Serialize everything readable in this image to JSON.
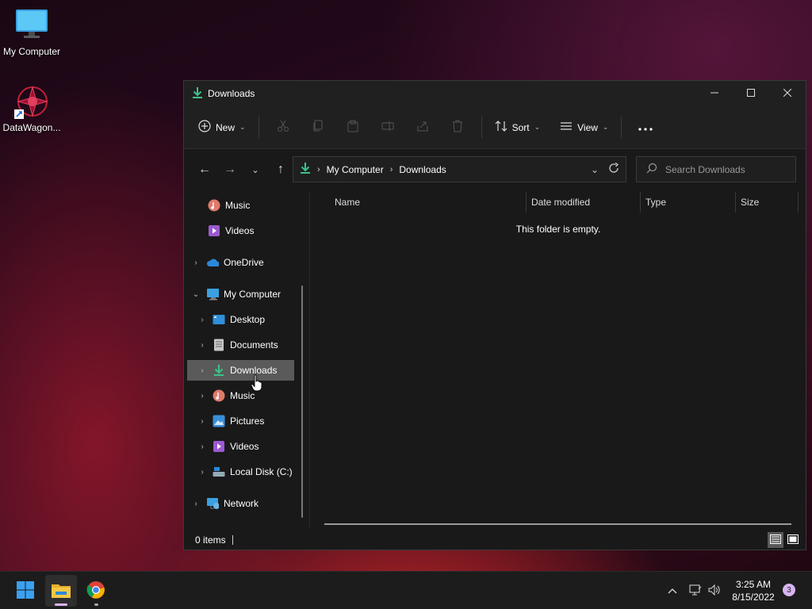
{
  "desktop": {
    "icons": [
      {
        "label": "My Computer",
        "icon": "monitor-icon"
      },
      {
        "label": "DataWagon...",
        "icon": "datawagon-shortcut-icon"
      }
    ]
  },
  "window": {
    "title": "Downloads",
    "controls": {
      "minimize": "minimize-icon",
      "maximize": "maximize-icon",
      "close": "close-icon"
    }
  },
  "toolbar": {
    "new_label": "New",
    "sort_label": "Sort",
    "view_label": "View",
    "disabled_actions": [
      "cut",
      "copy",
      "paste",
      "rename",
      "share",
      "delete"
    ]
  },
  "address": {
    "crumbs": [
      "My Computer",
      "Downloads"
    ],
    "search_placeholder": "Search Downloads"
  },
  "sidebar": {
    "items": [
      {
        "label": "Music",
        "icon": "music-icon",
        "expandable": false
      },
      {
        "label": "Videos",
        "icon": "videos-icon",
        "expandable": false
      },
      {
        "label": "OneDrive",
        "icon": "onedrive-icon",
        "expandable": true
      },
      {
        "label": "My Computer",
        "icon": "monitor-icon",
        "expandable": true,
        "expanded": true
      },
      {
        "label": "Desktop",
        "icon": "desktop-folder-icon",
        "expandable": true
      },
      {
        "label": "Documents",
        "icon": "documents-icon",
        "expandable": true
      },
      {
        "label": "Downloads",
        "icon": "download-icon",
        "expandable": true,
        "selected": true
      },
      {
        "label": "Music",
        "icon": "music-icon",
        "expandable": true
      },
      {
        "label": "Pictures",
        "icon": "pictures-icon",
        "expandable": true
      },
      {
        "label": "Videos",
        "icon": "videos-icon",
        "expandable": true
      },
      {
        "label": "Local Disk (C:)",
        "icon": "disk-icon",
        "expandable": true
      },
      {
        "label": "Network",
        "icon": "network-icon",
        "expandable": true
      }
    ]
  },
  "columns": [
    "Name",
    "Date modified",
    "Type",
    "Size"
  ],
  "empty_message": "This folder is empty.",
  "status": {
    "items_count": "0 items"
  },
  "taskbar": {
    "apps": [
      "start-icon",
      "file-explorer-icon",
      "chrome-icon"
    ],
    "time": "3:25 AM",
    "date": "8/15/2022",
    "notification_count": "3"
  },
  "colors": {
    "accent": "#3cc48a",
    "selection": "#5a5a5a",
    "window_bg": "#191919"
  }
}
